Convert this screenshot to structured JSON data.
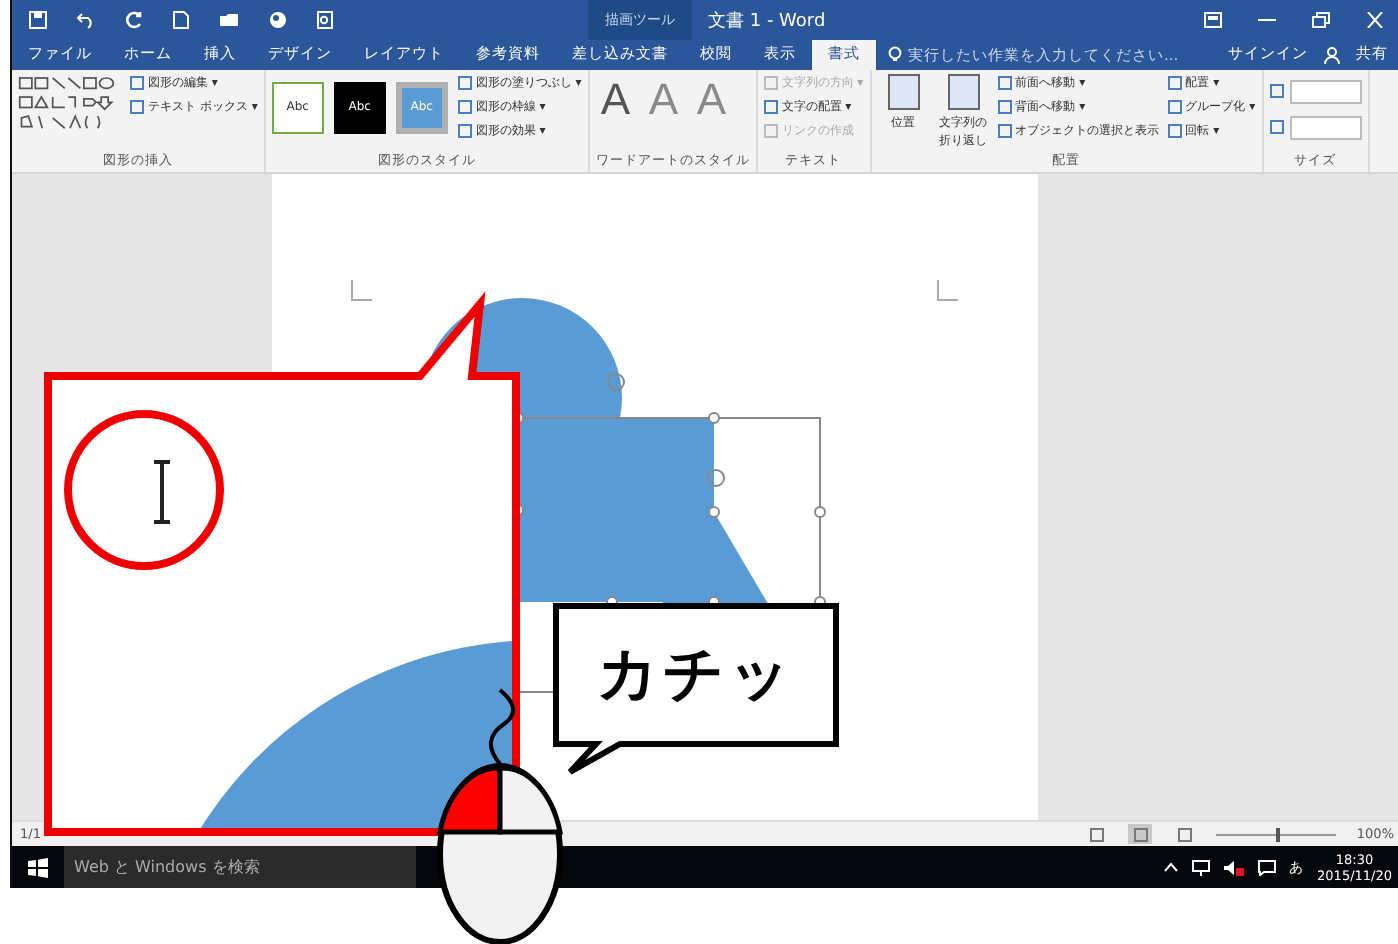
{
  "title_bar": {
    "context_label": "描画ツール",
    "title": "文書 1 - Word"
  },
  "tabs": [
    {
      "label": "ファイル",
      "selected": false
    },
    {
      "label": "ホーム",
      "selected": false
    },
    {
      "label": "挿入",
      "selected": false
    },
    {
      "label": "デザイン",
      "selected": false
    },
    {
      "label": "レイアウト",
      "selected": false
    },
    {
      "label": "参考資料",
      "selected": false
    },
    {
      "label": "差し込み文書",
      "selected": false
    },
    {
      "label": "校閲",
      "selected": false
    },
    {
      "label": "表示",
      "selected": false
    },
    {
      "label": "書式",
      "selected": true
    }
  ],
  "tell_me": {
    "placeholder": "実行したい作業を入力してください..."
  },
  "account": {
    "sign_in": "サインイン",
    "share": "共有"
  },
  "ribbon_groups": [
    {
      "kind": "shapes",
      "label": "図形の挿入",
      "items": [
        {
          "label": "図形の編集 ▾",
          "disabled": false
        },
        {
          "label": "テキスト ボックス ▾",
          "disabled": false
        }
      ]
    },
    {
      "kind": "styles",
      "label": "図形のスタイル",
      "styles": [
        {
          "label": "Abc",
          "kind": "outline",
          "selected": false
        },
        {
          "label": "Abc",
          "kind": "dark",
          "selected": false
        },
        {
          "label": "Abc",
          "kind": "blue",
          "selected": true
        }
      ],
      "items": [
        {
          "label": "図形の塗りつぶし ▾",
          "disabled": false
        },
        {
          "label": "図形の枠線 ▾",
          "disabled": false
        },
        {
          "label": "図形の効果 ▾",
          "disabled": false
        }
      ]
    },
    {
      "kind": "wordart",
      "label": "ワードアートのスタイル",
      "letters": [
        "A",
        "A",
        "A"
      ]
    },
    {
      "kind": "buttons",
      "label": "テキスト",
      "items": [
        {
          "label": "文字列の方向 ▾",
          "disabled": true
        },
        {
          "label": "文字の配置 ▾",
          "disabled": false
        },
        {
          "label": "リンクの作成",
          "disabled": true
        }
      ]
    },
    {
      "kind": "arrange",
      "label": "配置",
      "big": [
        "位置",
        "文字列の折り返し"
      ],
      "items": [
        {
          "label": "前面へ移動 ▾",
          "disabled": false
        },
        {
          "label": "背面へ移動 ▾",
          "disabled": false
        },
        {
          "label": "オブジェクトの選択と表示",
          "disabled": false
        },
        {
          "label": "配置 ▾",
          "disabled": false
        },
        {
          "label": "グループ化 ▾",
          "disabled": false
        },
        {
          "label": "回転 ▾",
          "disabled": false
        }
      ]
    },
    {
      "kind": "size",
      "label": "サイズ"
    }
  ],
  "status_bar": {
    "page": "1/1",
    "zoom": "100%",
    "zoom_level": {
      "level": 0.5
    }
  },
  "taskbar": {
    "search": {
      "placeholder": "Web と Windows を検索"
    },
    "ime": "あ",
    "time": "18:30",
    "date": "2015/11/20"
  },
  "speech_bubble": {
    "text": "カチッ"
  }
}
